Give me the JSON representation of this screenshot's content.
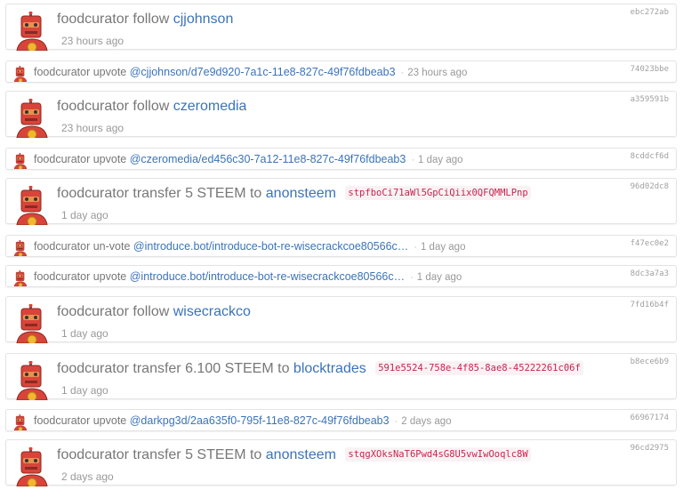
{
  "feed": [
    {
      "kind": "big",
      "user": "foodcurator",
      "verb": "follow",
      "link": "cjjohnson",
      "memo": "",
      "time": "23 hours ago",
      "hash": "ebc272ab"
    },
    {
      "kind": "small",
      "user": "foodcurator",
      "verb": "upvote",
      "link": "@cjjohnson/d7e9d920-7a1c-11e8-827c-49f76fdbeab3",
      "memo": "",
      "time": "23 hours ago",
      "hash": "74023bbe"
    },
    {
      "kind": "big",
      "user": "foodcurator",
      "verb": "follow",
      "link": "czeromedia",
      "memo": "",
      "time": "23 hours ago",
      "hash": "a359591b"
    },
    {
      "kind": "small",
      "user": "foodcurator",
      "verb": "upvote",
      "link": "@czeromedia/ed456c30-7a12-11e8-827c-49f76fdbeab3",
      "memo": "",
      "time": "1 day ago",
      "hash": "8cddcf6d"
    },
    {
      "kind": "big",
      "user": "foodcurator",
      "verb": "transfer 5 STEEM to",
      "link": "anonsteem",
      "memo": "stpfboCi71aWl5GpCiQiix0QFQMMLPnp",
      "time": "1 day ago",
      "hash": "96d02dc8"
    },
    {
      "kind": "small",
      "user": "foodcurator",
      "verb": "un-vote",
      "link": "@introduce.bot/introduce-bot-re-wisecrackcoe80566c…",
      "memo": "",
      "time": "1 day ago",
      "hash": "f47ec0e2"
    },
    {
      "kind": "small",
      "user": "foodcurator",
      "verb": "upvote",
      "link": "@introduce.bot/introduce-bot-re-wisecrackcoe80566c…",
      "memo": "",
      "time": "1 day ago",
      "hash": "8dc3a7a3"
    },
    {
      "kind": "big",
      "user": "foodcurator",
      "verb": "follow",
      "link": "wisecrackco",
      "memo": "",
      "time": "1 day ago",
      "hash": "7fd16b4f"
    },
    {
      "kind": "big",
      "user": "foodcurator",
      "verb": "transfer 6.100 STEEM to",
      "link": "blocktrades",
      "memo": "591e5524-758e-4f85-8ae8-45222261c06f",
      "time": "1 day ago",
      "hash": "b8ece6b9"
    },
    {
      "kind": "small",
      "user": "foodcurator",
      "verb": "upvote",
      "link": "@darkpg3d/2aa635f0-795f-11e8-827c-49f76fdbeab3",
      "memo": "",
      "time": "2 days ago",
      "hash": "66967174"
    },
    {
      "kind": "big",
      "user": "foodcurator",
      "verb": "transfer 5 STEEM to",
      "link": "anonsteem",
      "memo": "stqgXOksNaT6Pwd4sG8U5vwIwOoqlc8W",
      "time": "2 days ago",
      "hash": "96cd2975"
    }
  ],
  "colors": {
    "link": "#3a73b9",
    "text": "#777777",
    "memo": "#c7254e",
    "avatar_red": "#d9443a"
  },
  "icons": {
    "avatar": "robot-avatar-icon"
  }
}
